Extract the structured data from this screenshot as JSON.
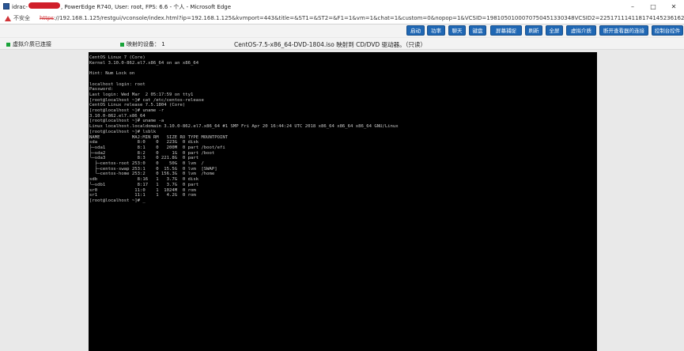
{
  "window": {
    "title_prefix": "idrac-",
    "title_suffix": ", PowerEdge R740, User: root, FPS: 6.6 - 个人 - Microsoft Edge"
  },
  "addressbar": {
    "insecure_label": "不安全",
    "scheme": "https",
    "url_rest": "://192.168.1.125/restgui/vconsole/index.html?ip=192.168.1.125&kvmport=443&title=&ST1=&ST2=&F1=1&vm=1&chat=1&custom=0&nopop=1&VCSID=1981050100070750451330348VCSID2=2251711141181741452361628p..."
  },
  "toolbar": {
    "buttons": [
      "启动",
      "功率",
      "聊天",
      "键盘",
      "屏幕捕捉",
      "刷新",
      "全屏",
      "虚拟介质",
      "断开查看器的连接",
      "控制台控件"
    ]
  },
  "status": {
    "vmedia": "虚拟介质已连接",
    "mapped_devices": "映射的设备： 1",
    "media_info": "CentOS-7.5-x86_64-DVD-1804.iso 映射到 CD/DVD 驱动器。（只读）"
  },
  "console": {
    "lines": [
      "CentOS Linux 7 (Core)",
      "Kernel 3.10.0-862.el7.x86_64 on an x86_64",
      "",
      "Hint: Num Lock on",
      "",
      "localhost login: root",
      "Password:",
      "Last login: Wed Mar  2 05:17:59 on tty1",
      "[root@localhost ~]# cat /etc/centos-release",
      "CentOS Linux release 7.5.1804 (Core)",
      "[root@localhost ~]# uname -r",
      "3.10.0-862.el7.x86_64",
      "[root@localhost ~]# uname -a",
      "Linux localhost.localdomain 3.10.0-862.el7.x86_64 #1 SMP Fri Apr 20 16:44:24 UTC 2018 x86_64 x86_64 x86_64 GNU/Linux",
      "[root@localhost ~]# lsblk",
      "NAME            MAJ:MIN RM   SIZE RO TYPE MOUNTPOINT",
      "sda               8:0    0   223G  0 disk",
      "├─sda1            8:1    0   200M  0 part /boot/efi",
      "├─sda2            8:2    0     1G  0 part /boot",
      "└─sda3            8:3    0 221.8G  0 part",
      "  ├─centos-root 253:0    0    50G  0 lvm  /",
      "  ├─centos-swap 253:1    0  15.5G  0 lvm  [SWAP]",
      "  └─centos-home 253:2    0 156.3G  0 lvm  /home",
      "sdb               8:16   1   3.7G  0 disk",
      "└─sdb1            8:17   1   3.7G  0 part",
      "sr0              11:0    1  1024M  0 rom",
      "sr1              11:1    1   4.2G  0 rom",
      "[root@localhost ~]# _"
    ]
  }
}
